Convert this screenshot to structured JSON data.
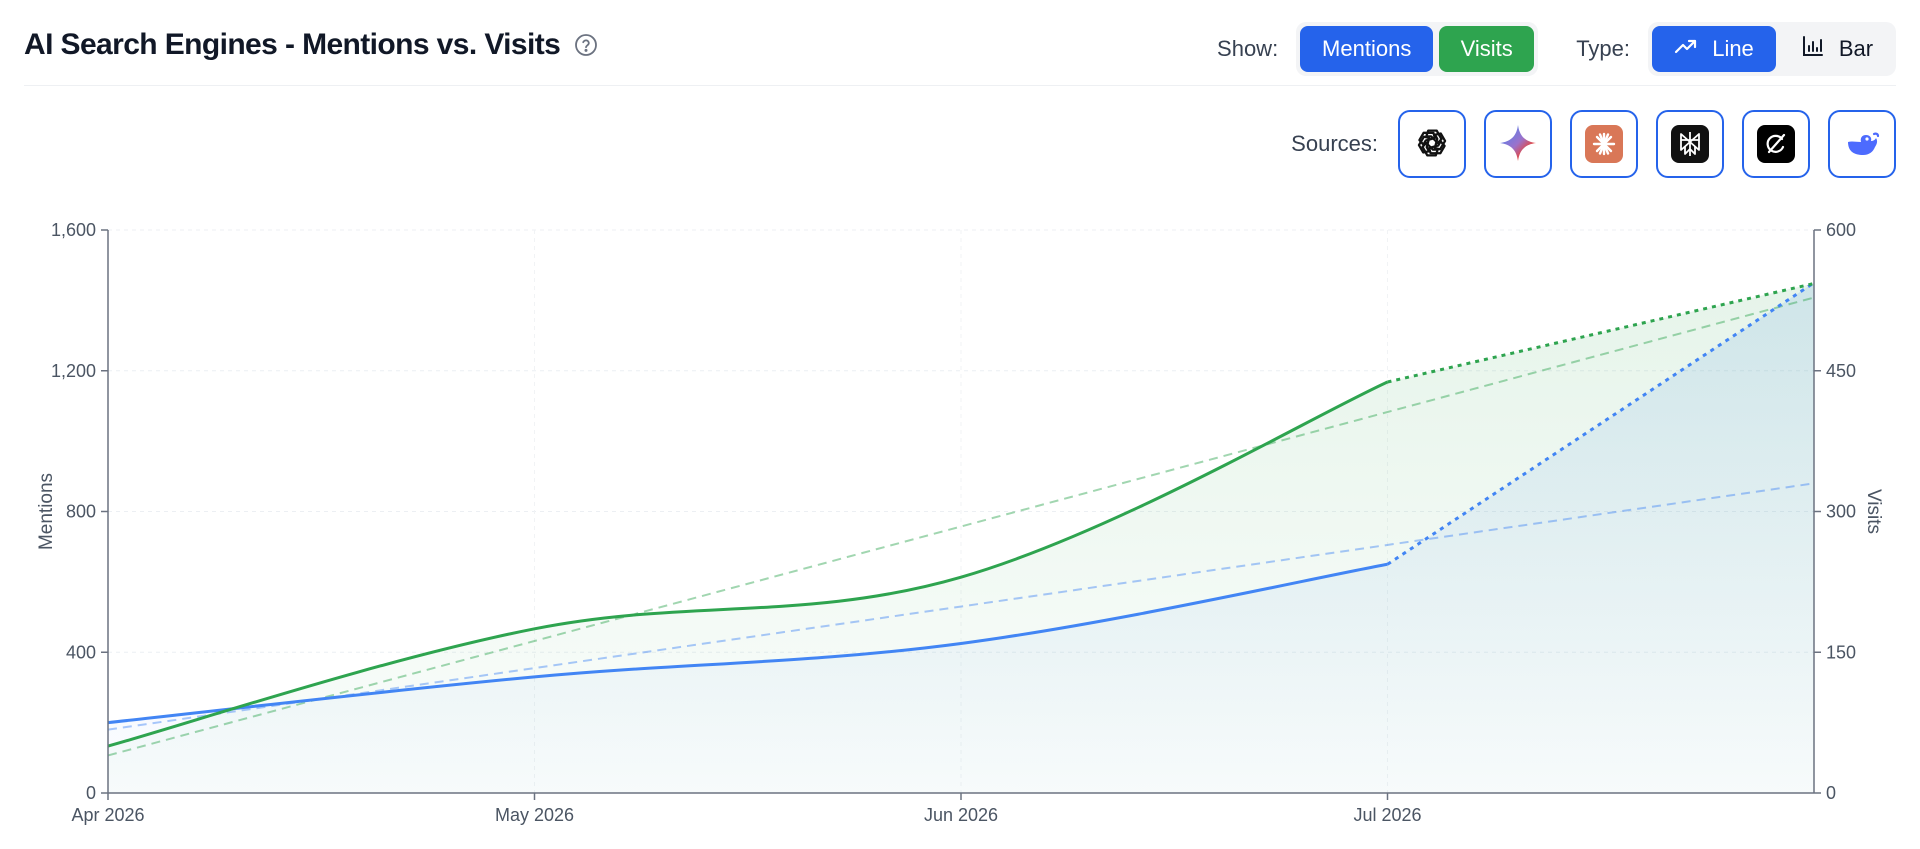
{
  "header": {
    "title": "AI Search Engines - Mentions vs. Visits",
    "help_icon": "question-circle-icon"
  },
  "controls": {
    "show_label": "Show:",
    "mentions_label": "Mentions",
    "visits_label": "Visits",
    "type_label": "Type:",
    "line_label": "Line",
    "bar_label": "Bar"
  },
  "sources": {
    "label": "Sources:",
    "items": [
      {
        "name": "chatgpt",
        "icon": "openai-icon"
      },
      {
        "name": "gemini",
        "icon": "gemini-icon"
      },
      {
        "name": "claude",
        "icon": "claude-icon"
      },
      {
        "name": "perplexity",
        "icon": "perplexity-icon"
      },
      {
        "name": "grok",
        "icon": "grok-icon"
      },
      {
        "name": "deepseek",
        "icon": "deepseek-icon"
      }
    ]
  },
  "colors": {
    "mentions": "#4285f4",
    "visits": "#2ea44f",
    "button_blue": "#2563eb",
    "button_green": "#2ea44f",
    "gemini": "#4285f4",
    "claude": "#d97757",
    "perplexity": "#111111",
    "grok": "#000000",
    "deepseek": "#4d6bfe"
  },
  "chart_data": {
    "type": "line",
    "x": [
      "Apr 2026",
      "May 2026",
      "Jun 2026",
      "Jul 2026",
      "Aug 2026"
    ],
    "x_tick_labels": [
      "Apr 2026",
      "May 2026",
      "Jun 2026",
      "Jul 2026"
    ],
    "series": [
      {
        "name": "Mentions",
        "axis": "left",
        "color": "#4285f4",
        "values": [
          200,
          330,
          425,
          650,
          1450
        ],
        "projected_from_index": 3,
        "trend": [
          180,
          880
        ]
      },
      {
        "name": "Visits",
        "axis": "right",
        "color": "#2ea44f",
        "values": [
          50,
          175,
          230,
          438,
          543
        ],
        "projected_from_index": 3,
        "trend": [
          40,
          528
        ]
      }
    ],
    "y_left": {
      "label": "Mentions",
      "min": 0,
      "max": 1600,
      "ticks": [
        0,
        400,
        800,
        1200,
        1600
      ],
      "tick_labels": [
        "0",
        "400",
        "800",
        "1,200",
        "1,600"
      ]
    },
    "y_right": {
      "label": "Visits",
      "min": 0,
      "max": 600,
      "ticks": [
        0,
        150,
        300,
        450,
        600
      ],
      "tick_labels": [
        "0",
        "150",
        "300",
        "450",
        "600"
      ]
    },
    "grid": true,
    "legend": "none"
  }
}
